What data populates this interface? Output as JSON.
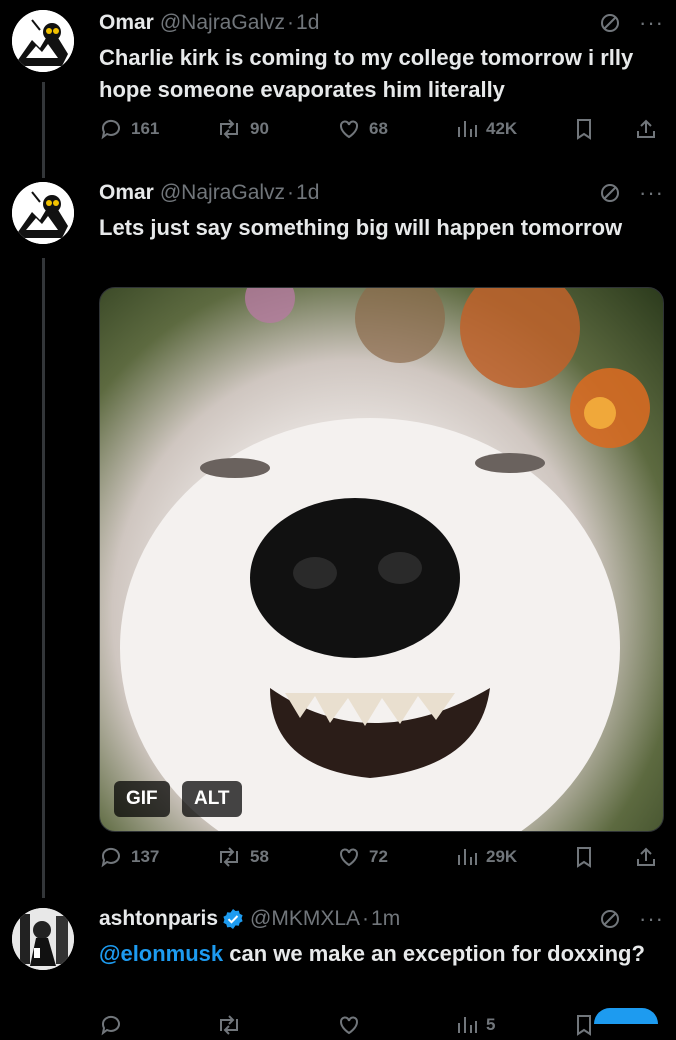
{
  "tweets": [
    {
      "name": "Omar",
      "handle": "@NajraGalvz",
      "time": "1d",
      "text": "Charlie kirk is coming to my college tomorrow i rlly hope someone evaporates him literally",
      "replies": "161",
      "reposts": "90",
      "likes": "68",
      "views": "42K"
    },
    {
      "name": "Omar",
      "handle": "@NajraGalvz",
      "time": "1d",
      "text": "Lets just say something big will happen tomorrow",
      "media": {
        "gif_label": "GIF",
        "alt_label": "ALT"
      },
      "replies": "137",
      "reposts": "58",
      "likes": "72",
      "views": "29K"
    },
    {
      "name": "ashtonparis",
      "handle": "@MKMXLA",
      "time": "1m",
      "mention": "@elonmusk",
      "text": " can we make an exception for doxxing?",
      "replies": "",
      "reposts": "",
      "likes": "",
      "views": "5"
    }
  ],
  "colors": {
    "accent": "#1d9bf0",
    "muted": "#71767b",
    "background": "#000000"
  },
  "icons": [
    "no-entry-icon",
    "more-icon",
    "reply-icon",
    "repost-icon",
    "like-icon",
    "views-icon",
    "bookmark-icon",
    "share-icon",
    "verified-icon"
  ]
}
